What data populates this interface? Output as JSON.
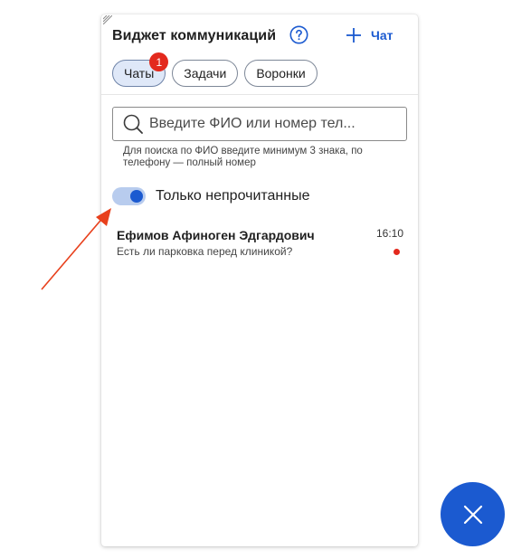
{
  "colors": {
    "accent": "#1b5ad0",
    "badge": "#e3291d",
    "tab_active_bg": "#dfe8f8",
    "toggle_track": "#b8ccee",
    "annotation_arrow": "#e8401c"
  },
  "widget": {
    "title": "Виджет коммуникаций",
    "help_icon": "question-circle-icon",
    "new_chat_label": "Чат",
    "new_chat_icon": "plus-icon"
  },
  "tabs": [
    {
      "label": "Чаты",
      "active": true,
      "badge": "1"
    },
    {
      "label": "Задачи",
      "active": false
    },
    {
      "label": "Воронки",
      "active": false
    }
  ],
  "search": {
    "placeholder": "Введите ФИО или номер тел...",
    "value": "",
    "hint": "Для поиска по ФИО введите минимум 3 знака, по телефону — полный номер"
  },
  "filter": {
    "label": "Только непрочитанные",
    "enabled": true
  },
  "chats": [
    {
      "name": "Ефимов Афиноген Эдгардович",
      "time": "16:10",
      "message": "Есть ли парковка перед клиникой?",
      "unread": true
    }
  ],
  "fab": {
    "icon": "close-icon"
  }
}
